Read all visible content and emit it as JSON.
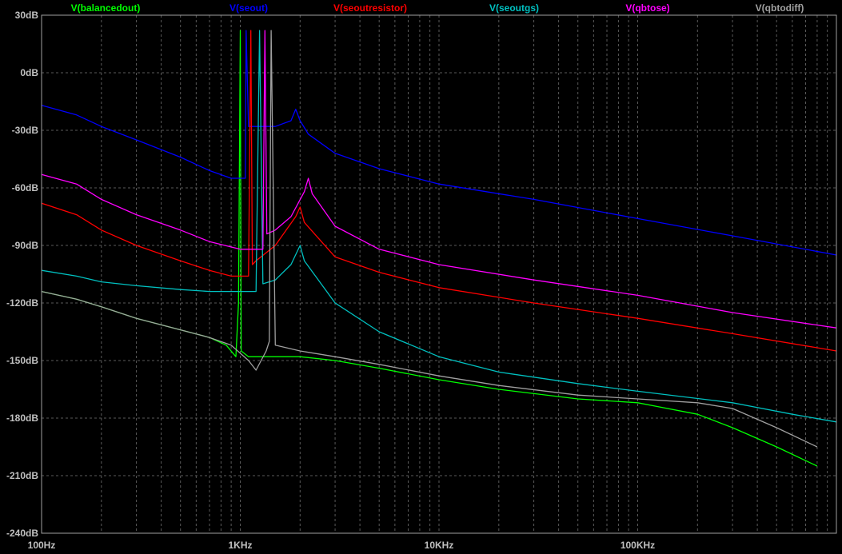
{
  "chart_data": {
    "type": "line",
    "title": "",
    "xlabel": "",
    "ylabel": "",
    "x_scale": "log",
    "xlim": [
      100,
      1000000
    ],
    "ylim": [
      -240,
      30
    ],
    "grid": true,
    "legend_placement": "top",
    "x_tick_labels": [
      {
        "value": 100,
        "label": "100Hz"
      },
      {
        "value": 1000,
        "label": "1KHz"
      },
      {
        "value": 10000,
        "label": "10KHz"
      },
      {
        "value": 100000,
        "label": "100KHz"
      }
    ],
    "y_tick_labels": [
      {
        "value": 30,
        "label": "30dB"
      },
      {
        "value": 0,
        "label": "0dB"
      },
      {
        "value": -30,
        "label": "-30dB"
      },
      {
        "value": -60,
        "label": "-60dB"
      },
      {
        "value": -90,
        "label": "-90dB"
      },
      {
        "value": -120,
        "label": "-120dB"
      },
      {
        "value": -150,
        "label": "-150dB"
      },
      {
        "value": -180,
        "label": "-180dB"
      },
      {
        "value": -210,
        "label": "-210dB"
      },
      {
        "value": -240,
        "label": "-240dB"
      }
    ],
    "series": [
      {
        "name": "V(balancedout)",
        "color": "#00ff00",
        "x": [
          100,
          150,
          200,
          300,
          500,
          700,
          850,
          950,
          980,
          1000,
          1010,
          1100,
          1150,
          1300,
          1500,
          2000,
          3000,
          5000,
          10000,
          20000,
          50000,
          100000,
          200000,
          300000,
          500000,
          800000
        ],
        "y": [
          -114,
          -118,
          -122,
          -128,
          -134,
          -138,
          -142,
          -148,
          -120,
          22,
          -145,
          -148,
          -148,
          -148,
          -148,
          -148,
          -150,
          -154,
          -160,
          -165,
          -170,
          -172,
          -178,
          -185,
          -195,
          -205
        ]
      },
      {
        "name": "V(seout)",
        "color": "#0000ff",
        "x": [
          100,
          150,
          200,
          300,
          500,
          700,
          900,
          1000,
          1060,
          1070,
          1100,
          1500,
          1800,
          1900,
          2000,
          2200,
          3000,
          5000,
          10000,
          30000,
          100000,
          300000,
          1000000
        ],
        "y": [
          -17,
          -22,
          -28,
          -35,
          -44,
          -51,
          -55,
          -55,
          -55,
          22,
          -28,
          -28,
          -25,
          -19,
          -25,
          -32,
          -42,
          -50,
          -58,
          -66,
          -76,
          -85,
          -95
        ]
      },
      {
        "name": "V(seoutresistor)",
        "color": "#ff0000",
        "x": [
          100,
          150,
          200,
          300,
          500,
          700,
          900,
          1000,
          1100,
          1130,
          1150,
          1200,
          1500,
          1900,
          2000,
          2100,
          3000,
          5000,
          10000,
          30000,
          100000,
          300000,
          1000000
        ],
        "y": [
          -68,
          -74,
          -82,
          -90,
          -98,
          -103,
          -106,
          -106,
          -106,
          22,
          -100,
          -98,
          -90,
          -75,
          -70,
          -78,
          -96,
          -104,
          -112,
          -120,
          -128,
          -136,
          -145
        ]
      },
      {
        "name": "V(seoutgs)",
        "color": "#00c0c0",
        "x": [
          100,
          150,
          200,
          300,
          500,
          700,
          1000,
          1200,
          1250,
          1300,
          1500,
          1800,
          2000,
          2100,
          3000,
          5000,
          10000,
          20000,
          50000,
          100000,
          300000,
          600000,
          1000000
        ],
        "y": [
          -103,
          -106,
          -109,
          -111,
          -113,
          -114,
          -114,
          -114,
          22,
          -110,
          -108,
          -100,
          -90,
          -98,
          -120,
          -135,
          -148,
          -156,
          -162,
          -166,
          -172,
          -178,
          -182
        ]
      },
      {
        "name": "V(qbtose)",
        "color": "#ff00ff",
        "x": [
          100,
          150,
          200,
          300,
          500,
          700,
          1000,
          1200,
          1300,
          1330,
          1360,
          1500,
          1800,
          2100,
          2200,
          2300,
          3000,
          5000,
          10000,
          30000,
          100000,
          300000,
          1000000
        ],
        "y": [
          -53,
          -58,
          -66,
          -74,
          -82,
          -88,
          -92,
          -92,
          -92,
          22,
          -84,
          -82,
          -75,
          -62,
          -55,
          -63,
          -80,
          -92,
          -100,
          -108,
          -116,
          -125,
          -133
        ]
      },
      {
        "name": "V(qbtodiff)",
        "color": "#a0a0a0",
        "x": [
          100,
          150,
          200,
          300,
          500,
          700,
          900,
          1100,
          1200,
          1350,
          1400,
          1430,
          1500,
          2000,
          3000,
          5000,
          10000,
          20000,
          50000,
          100000,
          200000,
          300000,
          500000,
          800000
        ],
        "y": [
          -114,
          -118,
          -122,
          -128,
          -134,
          -138,
          -142,
          -150,
          -155,
          -145,
          -140,
          22,
          -142,
          -145,
          -148,
          -152,
          -158,
          -163,
          -168,
          -170,
          -172,
          -175,
          -185,
          -195
        ]
      }
    ]
  }
}
